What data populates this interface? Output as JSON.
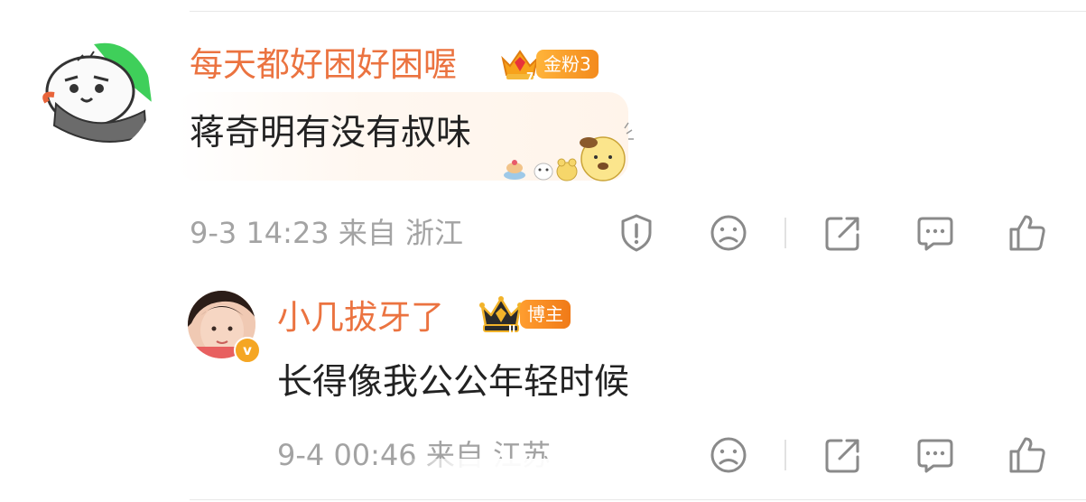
{
  "comments": [
    {
      "username": "每天都好困好困喔",
      "badge": "金粉3",
      "badge_level": "7",
      "text": "蒋奇明有没有叔味",
      "timestamp": "9-3 14:23",
      "location": "来自 浙江",
      "actions": [
        "report-icon",
        "dislike-icon",
        "share-icon",
        "comment-icon",
        "like-icon"
      ]
    },
    {
      "username": "小几拔牙了",
      "badge": "博主",
      "badge_level": "II",
      "verified": "v",
      "text": "长得像我公公年轻时候",
      "timestamp": "9-4 00:46",
      "location": "来自 江苏",
      "actions": [
        "dislike-icon",
        "share-icon",
        "comment-icon",
        "like-icon"
      ]
    }
  ],
  "colors": {
    "username": "#eb7340",
    "meta": "#a3a3a3",
    "badge_orange": "#f38a1d",
    "text": "#222222"
  }
}
